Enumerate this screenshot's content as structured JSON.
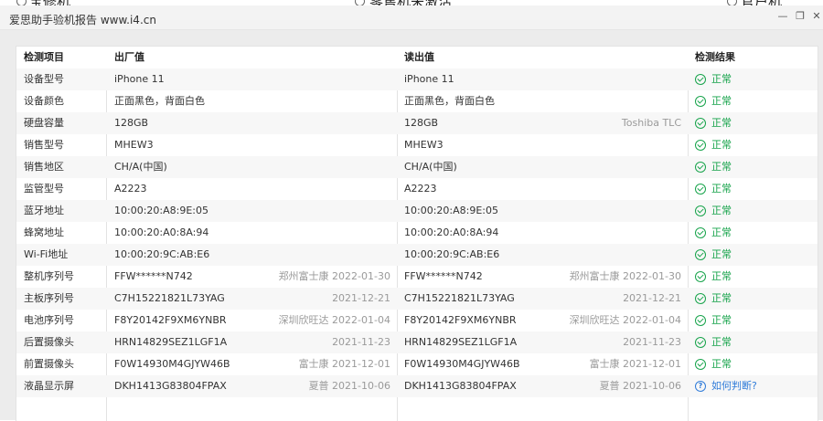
{
  "background_tabs": [
    "宝修机",
    "零售机未激活",
    "官户机"
  ],
  "window": {
    "title": "爱思助手验机报告 www.i4.cn",
    "buttons": [
      "minimize-icon",
      "restore-icon",
      "close-icon"
    ]
  },
  "table": {
    "headers": [
      "检测项目",
      "出厂值",
      "读出值",
      "检测结果"
    ],
    "rows": [
      {
        "item": "设备型号",
        "factory": "iPhone 11",
        "factory_note": "",
        "read": "iPhone 11",
        "read_note": "",
        "result": "正常",
        "status": "ok"
      },
      {
        "item": "设备颜色",
        "factory": "正面黑色，背面白色",
        "factory_note": "",
        "read": "正面黑色，背面白色",
        "read_note": "",
        "result": "正常",
        "status": "ok"
      },
      {
        "item": "硬盘容量",
        "factory": "128GB",
        "factory_note": "",
        "read": "128GB",
        "read_note": "Toshiba TLC",
        "result": "正常",
        "status": "ok"
      },
      {
        "item": "销售型号",
        "factory": "MHEW3",
        "factory_note": "",
        "read": "MHEW3",
        "read_note": "",
        "result": "正常",
        "status": "ok"
      },
      {
        "item": "销售地区",
        "factory": "CH/A(中国)",
        "factory_note": "",
        "read": "CH/A(中国)",
        "read_note": "",
        "result": "正常",
        "status": "ok"
      },
      {
        "item": "监管型号",
        "factory": "A2223",
        "factory_note": "",
        "read": "A2223",
        "read_note": "",
        "result": "正常",
        "status": "ok"
      },
      {
        "item": "蓝牙地址",
        "factory": "10:00:20:A8:9E:05",
        "factory_note": "",
        "read": "10:00:20:A8:9E:05",
        "read_note": "",
        "result": "正常",
        "status": "ok"
      },
      {
        "item": "蜂窝地址",
        "factory": "10:00:20:A0:8A:94",
        "factory_note": "",
        "read": "10:00:20:A0:8A:94",
        "read_note": "",
        "result": "正常",
        "status": "ok"
      },
      {
        "item": "Wi-Fi地址",
        "factory": "10:00:20:9C:AB:E6",
        "factory_note": "",
        "read": "10:00:20:9C:AB:E6",
        "read_note": "",
        "result": "正常",
        "status": "ok"
      },
      {
        "item": "整机序列号",
        "factory": "FFW******N742",
        "factory_note": "郑州富士康 2022-01-30",
        "read": "FFW******N742",
        "read_note": "郑州富士康 2022-01-30",
        "result": "正常",
        "status": "ok"
      },
      {
        "item": "主板序列号",
        "factory": "C7H15221821L73YAG",
        "factory_note": "2021-12-21",
        "read": "C7H15221821L73YAG",
        "read_note": "2021-12-21",
        "result": "正常",
        "status": "ok"
      },
      {
        "item": "电池序列号",
        "factory": "F8Y20142F9XM6YNBR",
        "factory_note": "深圳欣旺达 2022-01-04",
        "read": "F8Y20142F9XM6YNBR",
        "read_note": "深圳欣旺达 2022-01-04",
        "result": "正常",
        "status": "ok"
      },
      {
        "item": "后置摄像头",
        "factory": "HRN14829SEZ1LGF1A",
        "factory_note": "2021-11-23",
        "read": "HRN14829SEZ1LGF1A",
        "read_note": "2021-11-23",
        "result": "正常",
        "status": "ok"
      },
      {
        "item": "前置摄像头",
        "factory": "F0W14930M4GJYW46B",
        "factory_note": "富士康 2021-12-01",
        "read": "F0W14930M4GJYW46B",
        "read_note": "富士康 2021-12-01",
        "result": "正常",
        "status": "ok"
      },
      {
        "item": "液晶显示屏",
        "factory": "DKH1413G83804FPAX",
        "factory_note": "夏普 2021-10-06",
        "read": "DKH1413G83804FPAX",
        "read_note": "夏普 2021-10-06",
        "result": "如何判断?",
        "status": "help"
      }
    ]
  },
  "colors": {
    "ok": "#16a34a",
    "link": "#2f7bd9"
  }
}
